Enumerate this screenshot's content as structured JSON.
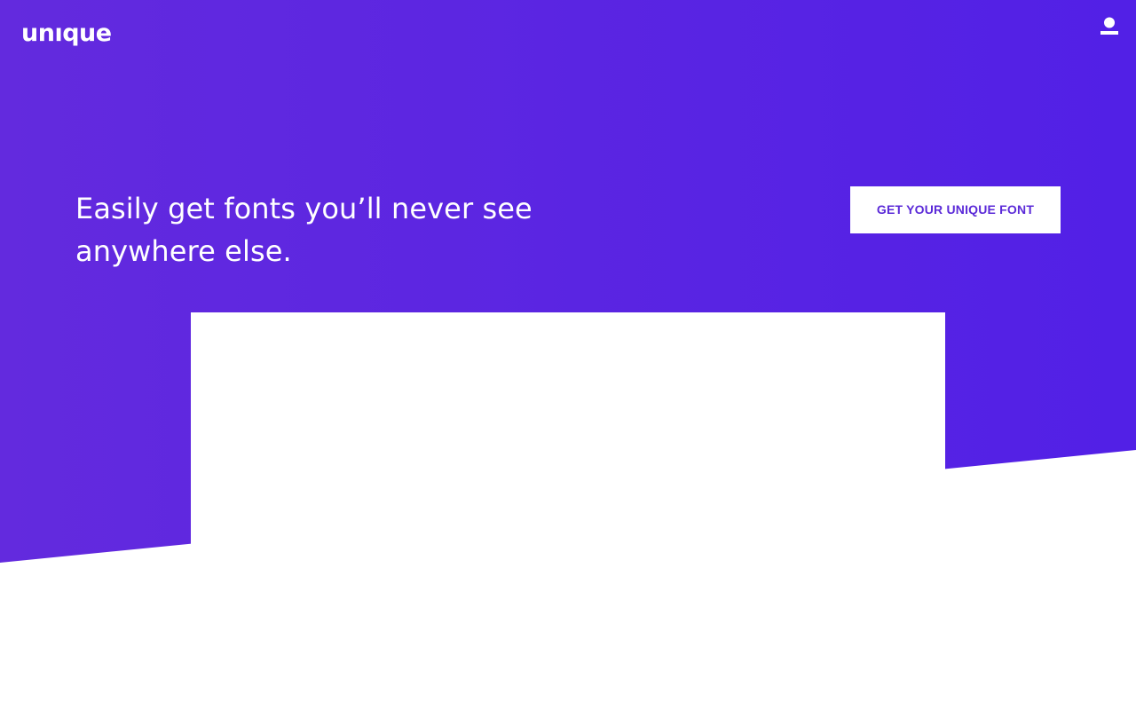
{
  "header": {
    "logo_text": "unıque",
    "account_icon": "user-icon"
  },
  "hero": {
    "headline": "Easily get fonts you’ll never see anywhere else.",
    "cta_label": "GET YOUR UNIQUE FONT"
  },
  "colors": {
    "gradient_start": "#632ade",
    "gradient_end": "#5220e6",
    "cta_text": "#5b2ad8",
    "content_panel": "#ffffff"
  }
}
